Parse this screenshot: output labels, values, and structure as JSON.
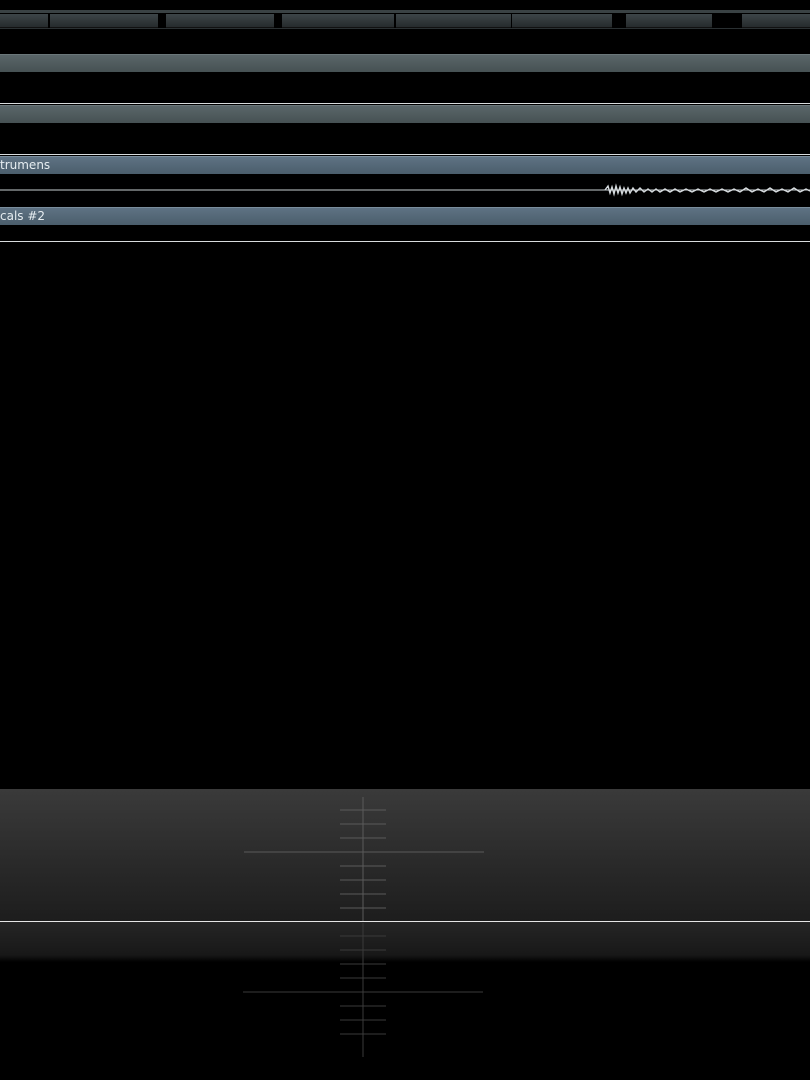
{
  "tracks": [
    {
      "name": "",
      "selected": false
    },
    {
      "name": "",
      "selected": false
    },
    {
      "name": "trumens",
      "selected": true
    },
    {
      "name": "cals #2",
      "selected": true
    }
  ],
  "colors": {
    "background": "#000000",
    "track_header": "#4f5a5d",
    "track_header_selected": "#546878",
    "waveform": "#c9cfd2",
    "meter_panel": "#2b2b2b"
  },
  "meter": {
    "icon": "phase-scope-crosshair-icon"
  }
}
